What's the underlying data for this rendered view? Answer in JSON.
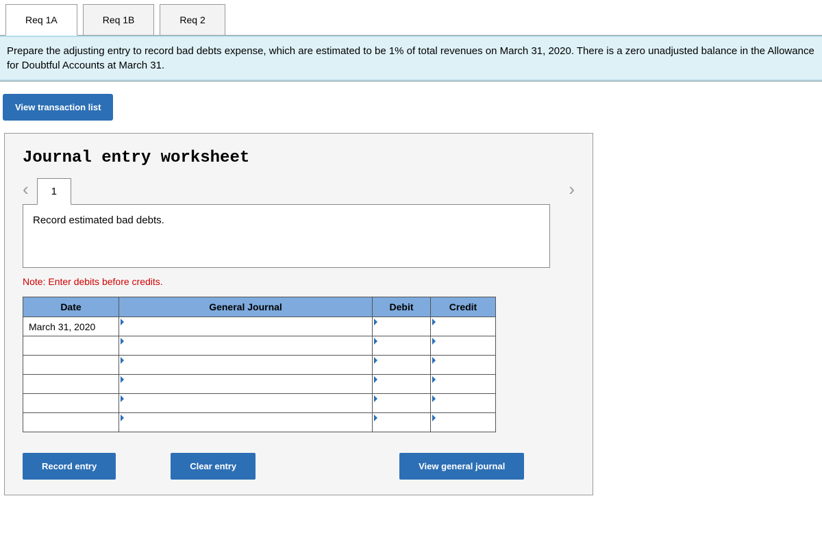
{
  "tabs": {
    "items": [
      {
        "label": "Req 1A",
        "active": true
      },
      {
        "label": "Req 1B",
        "active": false
      },
      {
        "label": "Req 2",
        "active": false
      }
    ]
  },
  "instruction": "Prepare the adjusting entry to record bad debts expense, which are estimated to be 1% of total revenues on March 31, 2020. There is a zero unadjusted balance in the Allowance for Doubtful Accounts at March 31.",
  "buttons": {
    "view_transaction_list": "View transaction list",
    "record_entry": "Record entry",
    "clear_entry": "Clear entry",
    "view_general_journal": "View general journal"
  },
  "worksheet": {
    "title": "Journal entry worksheet",
    "page": "1",
    "description": "Record estimated bad debts.",
    "note": "Note: Enter debits before credits.",
    "headers": {
      "date": "Date",
      "general_journal": "General Journal",
      "debit": "Debit",
      "credit": "Credit"
    },
    "rows": [
      {
        "date": "March 31, 2020",
        "gj": "",
        "debit": "",
        "credit": ""
      },
      {
        "date": "",
        "gj": "",
        "debit": "",
        "credit": ""
      },
      {
        "date": "",
        "gj": "",
        "debit": "",
        "credit": ""
      },
      {
        "date": "",
        "gj": "",
        "debit": "",
        "credit": ""
      },
      {
        "date": "",
        "gj": "",
        "debit": "",
        "credit": ""
      },
      {
        "date": "",
        "gj": "",
        "debit": "",
        "credit": ""
      }
    ]
  }
}
